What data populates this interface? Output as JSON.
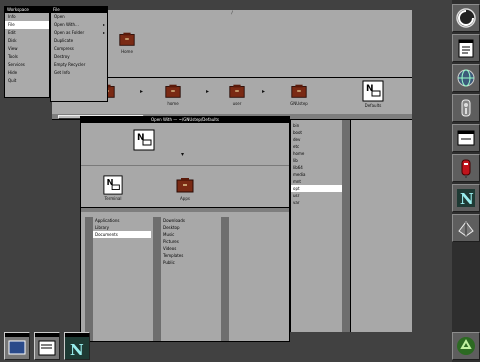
{
  "colors": {
    "desktop": "#414141",
    "window": "#aaaaaa",
    "titlebar": "#000000",
    "selection": "#ffffff",
    "folder": "#7a2a14"
  },
  "menu": {
    "title": "Workspace",
    "items": [
      {
        "label": "Info"
      },
      {
        "label": "File"
      },
      {
        "label": "Edit"
      },
      {
        "label": "Disk"
      },
      {
        "label": "View"
      },
      {
        "label": "Tools"
      },
      {
        "label": "Services"
      },
      {
        "label": "Hide"
      },
      {
        "label": "Quit"
      }
    ]
  },
  "submenu": {
    "title": "File",
    "items": [
      {
        "label": "Open"
      },
      {
        "label": "Open With...",
        "has_arrow": true
      },
      {
        "label": "Open as Folder",
        "has_arrow": true
      },
      {
        "label": "Duplicate"
      },
      {
        "label": "Compress"
      },
      {
        "label": "Destroy"
      },
      {
        "label": "Empty Recycler"
      },
      {
        "label": "Get Info"
      }
    ]
  },
  "viewer": {
    "title": "/",
    "shelf_icon": {
      "label": "Home",
      "icon": "folder-icon"
    },
    "path": [
      {
        "label": "",
        "icon": "folder-icon"
      },
      {
        "label": "home",
        "icon": "folder-icon"
      },
      {
        "label": "user",
        "icon": "folder-icon"
      },
      {
        "label": "GNUstep",
        "icon": "folder-icon"
      },
      {
        "label": "Defaults",
        "icon": "file-icon"
      }
    ]
  },
  "inspector": {
    "title": "Open With — ~/GNUstep/Defaults",
    "top_icon": {
      "label": "",
      "icon": "file-icon"
    },
    "items": [
      {
        "label": "Terminal",
        "icon": "file-icon"
      },
      {
        "label": "Apps",
        "icon": "folder-icon"
      }
    ],
    "lists": [
      {
        "items": [
          {
            "label": "Applications"
          },
          {
            "label": "Library"
          },
          {
            "label": "Documents",
            "selected": true
          }
        ]
      },
      {
        "items": [
          {
            "label": "Downloads"
          },
          {
            "label": "Desktop"
          },
          {
            "label": "Music"
          },
          {
            "label": "Pictures"
          },
          {
            "label": "Videos"
          },
          {
            "label": "Templates"
          },
          {
            "label": "Public"
          }
        ]
      }
    ]
  },
  "right_list": {
    "items": [
      {
        "label": "bin"
      },
      {
        "label": "boot"
      },
      {
        "label": "dev"
      },
      {
        "label": "etc"
      },
      {
        "label": "home"
      },
      {
        "label": "lib"
      },
      {
        "label": "lib64"
      },
      {
        "label": "media"
      },
      {
        "label": "mnt"
      },
      {
        "label": "opt",
        "selected": true
      },
      {
        "label": "usr"
      },
      {
        "label": "var"
      }
    ]
  },
  "dock": {
    "tiles": [
      {
        "name": "gnustep-icon"
      },
      {
        "name": "editor-icon"
      },
      {
        "name": "globe-icon"
      },
      {
        "name": "clock-icon"
      },
      {
        "name": "terminal-icon"
      },
      {
        "name": "mailbox-icon"
      },
      {
        "name": "next-icon"
      },
      {
        "name": "preferences-icon"
      },
      {
        "name": "recycler-icon"
      }
    ]
  },
  "miniwindows": [
    {
      "name": "viewer-miniwindow"
    },
    {
      "name": "editor-miniwindow"
    },
    {
      "name": "next-miniwindow"
    }
  ]
}
